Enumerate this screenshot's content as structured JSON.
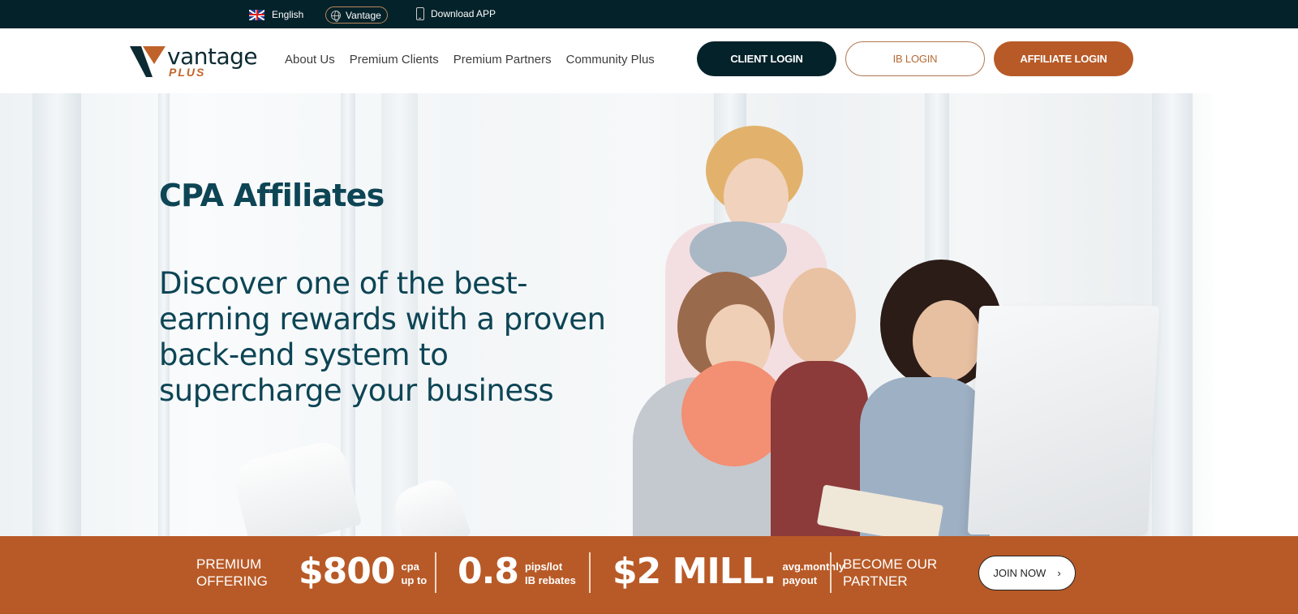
{
  "topbar": {
    "language": "English",
    "language_icon": "uk-flag-icon",
    "brand_switch": "Vantage",
    "brand_switch_icon": "globe-icon",
    "download": "Download APP",
    "download_icon": "mobile-phone-icon"
  },
  "header": {
    "logo_text": "vantage",
    "logo_sub": "PLUS",
    "nav": [
      {
        "label": "About Us"
      },
      {
        "label": "Premium Clients"
      },
      {
        "label": "Premium Partners"
      },
      {
        "label": "Community Plus"
      }
    ],
    "buttons": {
      "client_login": "CLIENT LOGIN",
      "ib_login": "IB LOGIN",
      "affiliate_login": "AFFILIATE LOGIN"
    }
  },
  "hero": {
    "title": "CPA Affiliates",
    "subtitle": "Discover one of the best-earning rewards with a proven back-end system to supercharge your business"
  },
  "offer_strip": {
    "premium_label_1": "PREMIUM",
    "premium_label_2": "OFFERING",
    "stats": [
      {
        "value": "$800",
        "note_1": "cpa",
        "note_2": "up to"
      },
      {
        "value": "0.8",
        "note_1": "pips/lot",
        "note_2": "IB rebates"
      },
      {
        "value": "$2 MILL.",
        "note_1": "avg.monthly",
        "note_2": "payout"
      }
    ],
    "partner_label_1": "BECOME OUR",
    "partner_label_2": "PARTNER",
    "join_button": "JOIN NOW",
    "join_icon": "chevron-right-icon"
  },
  "colors": {
    "dark_navy": "#04222a",
    "brand_orange": "#b85a27",
    "heading_teal": "#0d4555"
  }
}
